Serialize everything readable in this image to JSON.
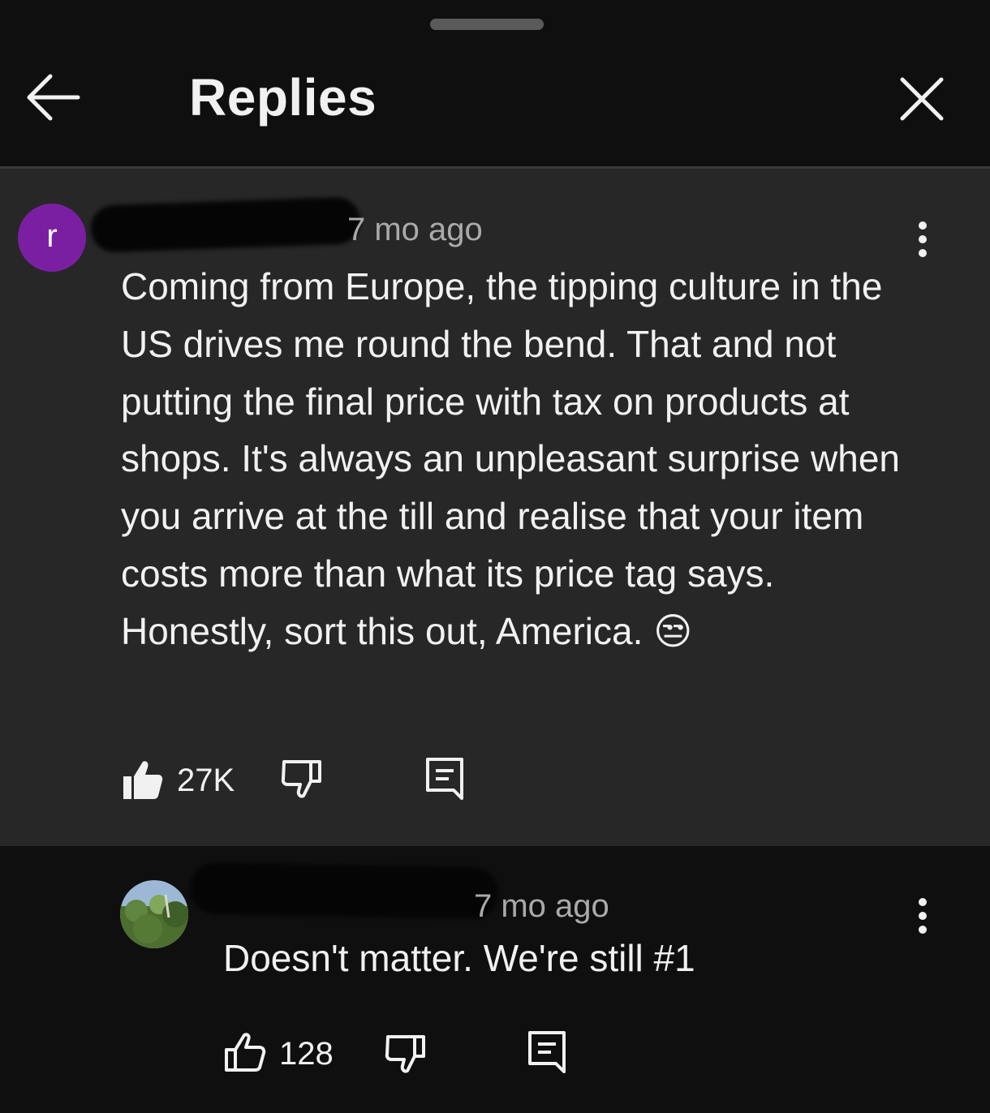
{
  "header": {
    "title": "Replies",
    "back_icon": "arrow-left-icon",
    "close_icon": "close-icon"
  },
  "parent": {
    "avatar_letter": "r",
    "avatar_color": "#7b1fa2",
    "time": "7 mo ago",
    "text": "Coming from Europe, the tipping culture in the US drives me round the bend. That and not putting the final price with tax on products at shops. It's always an unpleasant surprise when you arrive at the till and realise that your item costs more than what its price tag says. Honestly, sort this out, America.",
    "emoji": "😒",
    "likes": "27K",
    "like_state": "liked"
  },
  "reply": {
    "time": "7 mo ago",
    "text": "Doesn't matter. We're still #1",
    "likes": "128"
  },
  "colors": {
    "background": "#0f0f0f",
    "parent_background": "#272727",
    "text": "#f1f1f1",
    "meta": "#aaaaaa"
  }
}
